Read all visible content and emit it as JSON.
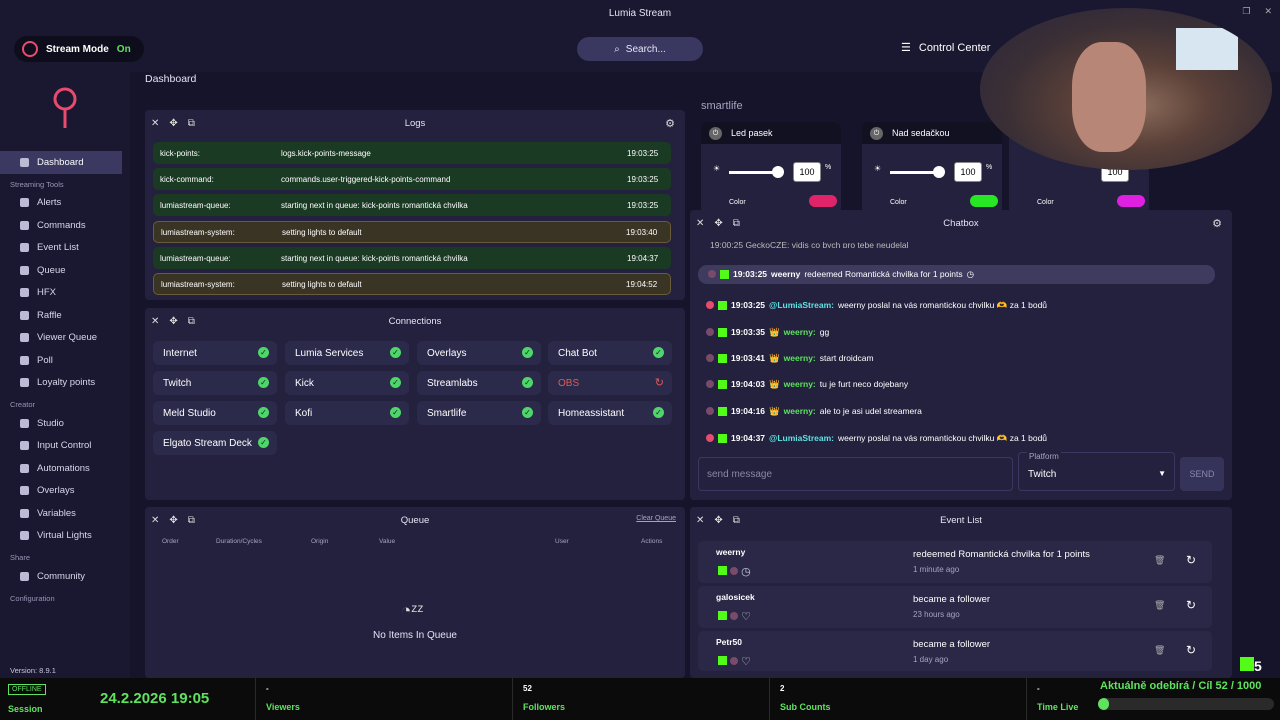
{
  "app": {
    "title": "Lumia Stream",
    "stream_mode_label": "Stream Mode",
    "stream_mode_state": "On",
    "search_placeholder": "Search...",
    "control_center": "Control Center",
    "page_title": "Dashboard",
    "version": "Version: 8.9.1"
  },
  "nav": {
    "dashboard": "Dashboard",
    "sec_streaming": "Streaming Tools",
    "alerts": "Alerts",
    "commands": "Commands",
    "event_list": "Event List",
    "queue": "Queue",
    "hfx": "HFX",
    "raffle": "Raffle",
    "viewer_queue": "Viewer Queue",
    "poll": "Poll",
    "loyalty": "Loyalty points",
    "sec_creator": "Creator",
    "studio": "Studio",
    "input_control": "Input Control",
    "automations": "Automations",
    "overlays": "Overlays",
    "variables": "Variables",
    "virtual_lights": "Virtual Lights",
    "sec_share": "Share",
    "community": "Community",
    "sec_config": "Configuration"
  },
  "logs": {
    "title": "Logs",
    "rows": [
      {
        "src": "kick-points:",
        "msg": "logs.kick-points-message",
        "time": "19:03:25"
      },
      {
        "src": "kick-command:",
        "msg": "commands.user-triggered-kick-points-command",
        "time": "19:03:25"
      },
      {
        "src": "lumiastream-queue:",
        "msg": "starting next in queue: kick-points romantická chvilka",
        "time": "19:03:25"
      },
      {
        "src": "lumiastream-system:",
        "msg": "setting lights to default",
        "time": "19:03:40"
      },
      {
        "src": "lumiastream-queue:",
        "msg": "starting next in queue: kick-points romantická chvilka",
        "time": "19:04:37"
      },
      {
        "src": "lumiastream-system:",
        "msg": "setting lights to default",
        "time": "19:04:52"
      }
    ]
  },
  "connections": {
    "title": "Connections",
    "items": [
      "Internet",
      "Lumia Services",
      "Overlays",
      "Chat Bot",
      "Twitch",
      "Kick",
      "Streamlabs",
      "OBS",
      "Meld Studio",
      "Kofi",
      "Smartlife",
      "Homeassistant",
      "Elgato Stream Deck"
    ]
  },
  "queue": {
    "title": "Queue",
    "clear": "Clear Queue",
    "cols": [
      "Order",
      "Duration/Cycles",
      "Origin",
      "Value",
      "User",
      "Actions"
    ],
    "empty": "No Items In Queue"
  },
  "smartlife": {
    "title": "smartlife",
    "devices": [
      {
        "name": "Led pasek",
        "brightness": "100",
        "color": "#e0246a"
      },
      {
        "name": "Nad sedačkou",
        "brightness": "100",
        "color": "#27e624"
      },
      {
        "name": "",
        "brightness": "100",
        "color": "#e020e0"
      }
    ],
    "color_label": "Color",
    "pct": "%"
  },
  "chatbox": {
    "title": "Chatbox",
    "partial": "19:00:25 GeckoCZE: vidis co bych pro tebe neudelal",
    "highlight": {
      "time": "19:03:25",
      "user": "weerny",
      "text": "redeemed Romantická chvilka for 1 points"
    },
    "lines": [
      {
        "time": "19:03:25",
        "user": "@LumiaStream:",
        "text": "weerny poslal na vás romantickou chvilku 🫶 za 1 bodů"
      },
      {
        "time": "19:03:35",
        "user": "weerny:",
        "text": "gg"
      },
      {
        "time": "19:03:41",
        "user": "weerny:",
        "text": "start droidcam"
      },
      {
        "time": "19:04:03",
        "user": "weerny:",
        "text": "tu je furt neco dojebany"
      },
      {
        "time": "19:04:16",
        "user": "weerny:",
        "text": "ale to je asi udel streamera"
      },
      {
        "time": "19:04:37",
        "user": "@LumiaStream:",
        "text": "weerny poslal na vás romantickou chvilku 🫶 za 1 bodů"
      }
    ],
    "input_placeholder": "send message",
    "platform_label": "Platform",
    "platform_value": "Twitch",
    "send": "SEND"
  },
  "events": {
    "title": "Event List",
    "items": [
      {
        "user": "weerny",
        "text": "redeemed Romantická chvilka for 1 points",
        "ago": "1 minute ago"
      },
      {
        "user": "galosicek",
        "text": "became a follower",
        "ago": "23 hours ago"
      },
      {
        "user": "Petr50",
        "text": "became a follower",
        "ago": "1 day ago"
      }
    ]
  },
  "footer": {
    "offline": "OFFLINE",
    "session": "Session",
    "date": "24.2.2026 19:05",
    "viewers_val": "-",
    "viewers": "Viewers",
    "followers_val": "52",
    "followers": "Followers",
    "subs_val": "2",
    "subs": "Sub Counts",
    "time_val": "-",
    "time": "Time Live",
    "goal_text": "Aktuálně odebírá / Cíl  52 / 1000",
    "goal_fraction": 0.052,
    "k5": "5"
  }
}
